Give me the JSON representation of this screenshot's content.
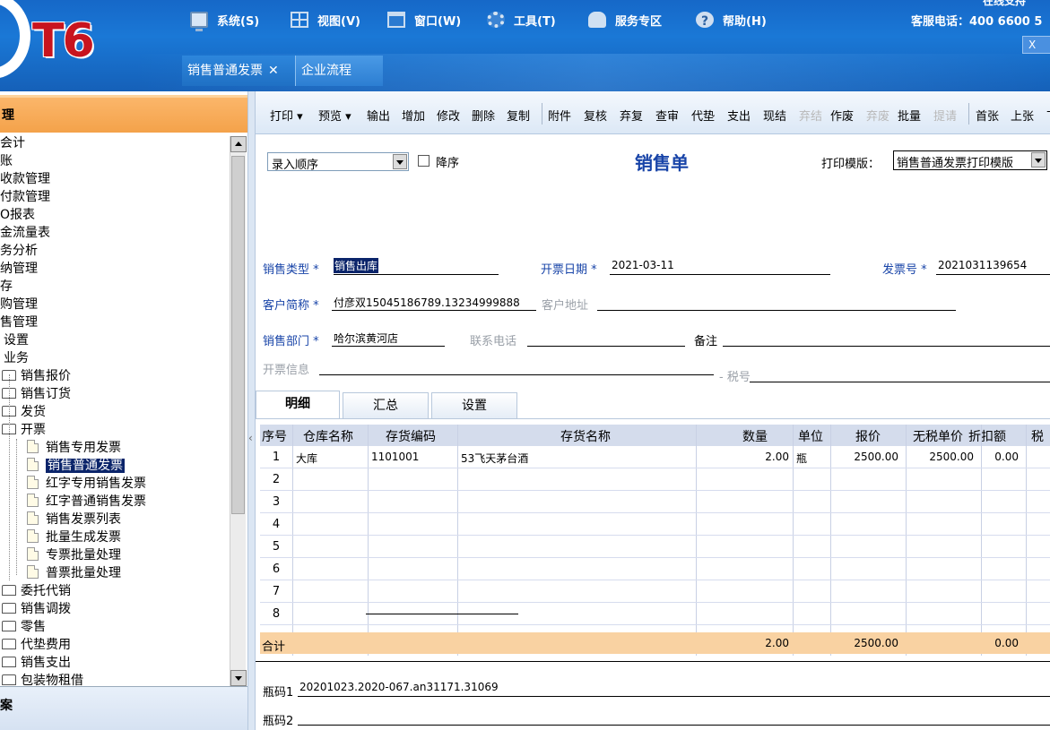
{
  "app": {
    "logo": "T6",
    "hotline": "客服电话：400 6600 5",
    "support": "在线支持",
    "close": "X"
  },
  "menu": [
    {
      "label": "系统(S)",
      "icon": "computer-icon"
    },
    {
      "label": "视图(V)",
      "icon": "grid-icon"
    },
    {
      "label": "窗口(W)",
      "icon": "window-icon"
    },
    {
      "label": "工具(T)",
      "icon": "gear-icon"
    },
    {
      "label": "服务专区",
      "icon": "user-icon"
    },
    {
      "label": "帮助(H)",
      "icon": "help-icon"
    }
  ],
  "doc_tabs": [
    {
      "label": "销售普通发票",
      "close": "✕"
    },
    {
      "label": "企业流程"
    }
  ],
  "left_panel": {
    "header": "理",
    "footer": "案",
    "tree": [
      {
        "label": "会计",
        "type": "text"
      },
      {
        "label": "账",
        "type": "text"
      },
      {
        "label": "收款管理",
        "type": "text"
      },
      {
        "label": "付款管理",
        "type": "text"
      },
      {
        "label": "O报表",
        "type": "text"
      },
      {
        "label": "金流量表",
        "type": "text"
      },
      {
        "label": "务分析",
        "type": "text"
      },
      {
        "label": "纳管理",
        "type": "text"
      },
      {
        "label": "存",
        "type": "text"
      },
      {
        "label": "购管理",
        "type": "text"
      },
      {
        "label": "售管理",
        "type": "text"
      },
      {
        "label": "设置",
        "type": "text"
      },
      {
        "label": "业务",
        "type": "text"
      },
      {
        "label": "销售报价",
        "type": "folder"
      },
      {
        "label": "销售订货",
        "type": "folder"
      },
      {
        "label": "发货",
        "type": "folder"
      },
      {
        "label": "开票",
        "type": "folder"
      },
      {
        "label": "销售专用发票",
        "type": "page"
      },
      {
        "label": "销售普通发票",
        "type": "page",
        "selected": true
      },
      {
        "label": "红字专用销售发票",
        "type": "page"
      },
      {
        "label": "红字普通销售发票",
        "type": "page"
      },
      {
        "label": "销售发票列表",
        "type": "page"
      },
      {
        "label": "批量生成发票",
        "type": "page"
      },
      {
        "label": "专票批量处理",
        "type": "page"
      },
      {
        "label": "普票批量处理",
        "type": "page"
      },
      {
        "label": "委托代销",
        "type": "folder"
      },
      {
        "label": "销售调拨",
        "type": "folder"
      },
      {
        "label": "零售",
        "type": "folder"
      },
      {
        "label": "代垫费用",
        "type": "folder"
      },
      {
        "label": "销售支出",
        "type": "folder"
      },
      {
        "label": "包装物租借",
        "type": "folder"
      }
    ]
  },
  "toolbar": {
    "items": [
      {
        "label": "打印 ▾"
      },
      {
        "label": "预览 ▾"
      },
      {
        "label": "输出"
      },
      {
        "label": "增加"
      },
      {
        "label": "修改"
      },
      {
        "label": "删除"
      },
      {
        "label": "复制"
      },
      {
        "label": "附件"
      },
      {
        "label": "复核"
      },
      {
        "label": "弃复"
      },
      {
        "label": "查审"
      },
      {
        "label": "代垫"
      },
      {
        "label": "支出"
      },
      {
        "label": "现结"
      },
      {
        "label": "弃结",
        "disabled": true
      },
      {
        "label": "作废"
      },
      {
        "label": "弃废",
        "disabled": true
      },
      {
        "label": "批量"
      },
      {
        "label": "提请",
        "disabled": true
      },
      {
        "label": "首张"
      },
      {
        "label": "上张"
      },
      {
        "label": "下"
      }
    ]
  },
  "form": {
    "order_select": "录入顺序",
    "descending_label": "降序",
    "title": "销售单",
    "template_label": "打印模版：",
    "template_value": "销售普通发票打印模版",
    "sales_type_label": "销售类型",
    "sales_type_value": "销售出库",
    "invoice_date_label": "开票日期",
    "invoice_date_value": "2021-03-11",
    "invoice_no_label": "发票号",
    "invoice_no_value": "2021031139654",
    "customer_label": "客户简称",
    "customer_value": "付彦双15045186789.13234999888",
    "address_label": "客户地址",
    "dept_label": "销售部门",
    "dept_value": "哈尔滨黄河店",
    "phone_label": "联系电话",
    "remark_label": "备注",
    "invoice_info_label": "开票信息",
    "tax_no_label": "税号",
    "required_mark": "*"
  },
  "tabs": {
    "detail": "明细",
    "summary": "汇总",
    "settings": "设置"
  },
  "grid": {
    "headers": [
      "序号",
      "仓库名称",
      "存货编码",
      "存货名称",
      "数量",
      "单位",
      "报价",
      "无税单价",
      "折扣额",
      "税"
    ],
    "rows": [
      {
        "no": "1",
        "warehouse": "大库",
        "code": "1101001",
        "name": "53飞天茅台酒",
        "qty": "2.00",
        "unit": "瓶",
        "price": "2500.00",
        "net_price": "2500.00",
        "discount": "0.00"
      },
      {
        "no": "2"
      },
      {
        "no": "3"
      },
      {
        "no": "4"
      },
      {
        "no": "5"
      },
      {
        "no": "6"
      },
      {
        "no": "7"
      },
      {
        "no": "8"
      }
    ],
    "total_label": "合计",
    "total_qty": "2.00",
    "total_price": "2500.00",
    "total_discount": "0.00"
  },
  "footer": {
    "bottle_code_1_label": "瓶码1",
    "bottle_code_1_value": "20201023.2020-067.an31171.31069",
    "bottle_code_2_label": "瓶码2"
  }
}
